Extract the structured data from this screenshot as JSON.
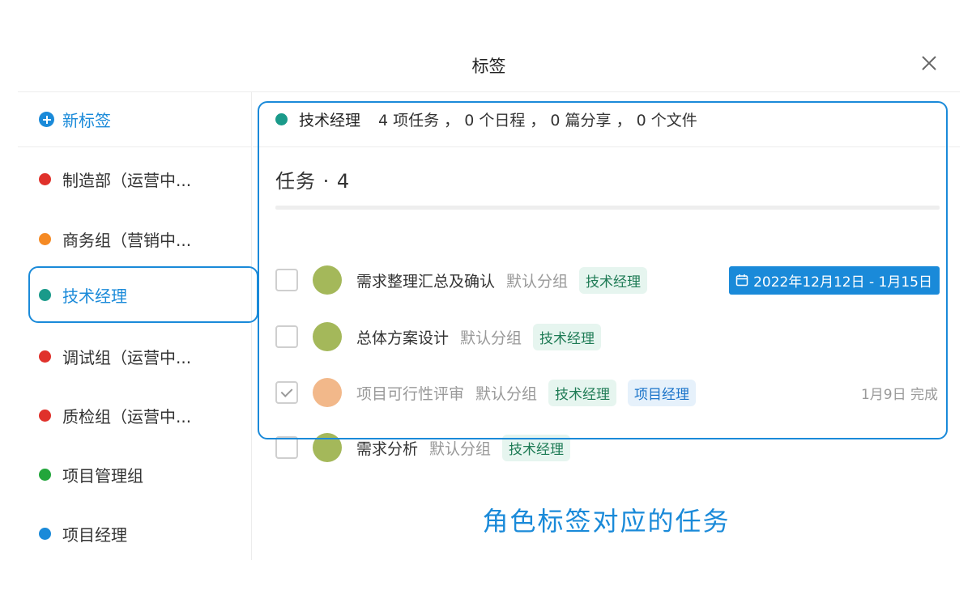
{
  "dialog": {
    "title": "标签",
    "close_icon": "close-icon"
  },
  "sidebar": {
    "new_tag_label": "新标签",
    "new_tag_icon": "plus-circle-icon",
    "items": [
      {
        "name": "制造部（运营中...",
        "color": "#e0312b"
      },
      {
        "name": "商务组（营销中...",
        "color": "#f58a24"
      },
      {
        "name": "技术经理",
        "color": "#1a9a8a",
        "active": true
      },
      {
        "name": "调试组（运营中...",
        "color": "#e0312b"
      },
      {
        "name": "质检组（运营中...",
        "color": "#e0312b"
      },
      {
        "name": "项目管理组",
        "color": "#22a63b"
      },
      {
        "name": "项目经理",
        "color": "#1a8ad9"
      }
    ]
  },
  "main": {
    "summary": {
      "tag_name": "技术经理",
      "tag_color": "#1a9a8a",
      "stats": "4 项任务 ， 0 个日程 ， 0 篇分享 ， 0 个文件"
    },
    "section_title": "任务 · 4",
    "tasks": [
      {
        "title": "需求整理汇总及确认",
        "group": "默认分组",
        "tags": [
          "技术经理"
        ],
        "date": "2022年12月12日 - 1月15日",
        "done": false,
        "avatar_color": "#a4b85a"
      },
      {
        "title": "总体方案设计",
        "group": "默认分组",
        "tags": [
          "技术经理"
        ],
        "done": false,
        "avatar_color": "#a4b85a"
      },
      {
        "title": "项目可行性评审",
        "group": "默认分组",
        "tags": [
          "技术经理",
          "项目经理"
        ],
        "status": "1月9日 完成",
        "done": true,
        "avatar_color": "#f2b88a"
      },
      {
        "title": "需求分析",
        "group": "默认分组",
        "tags": [
          "技术经理"
        ],
        "done": false,
        "avatar_color": "#a4b85a"
      }
    ],
    "caption": "角色标签对应的任务"
  },
  "colors": {
    "accent": "#1a8ad9",
    "tag_green_bg": "#e6f5ef",
    "tag_blue_bg": "#e6f1fb"
  }
}
